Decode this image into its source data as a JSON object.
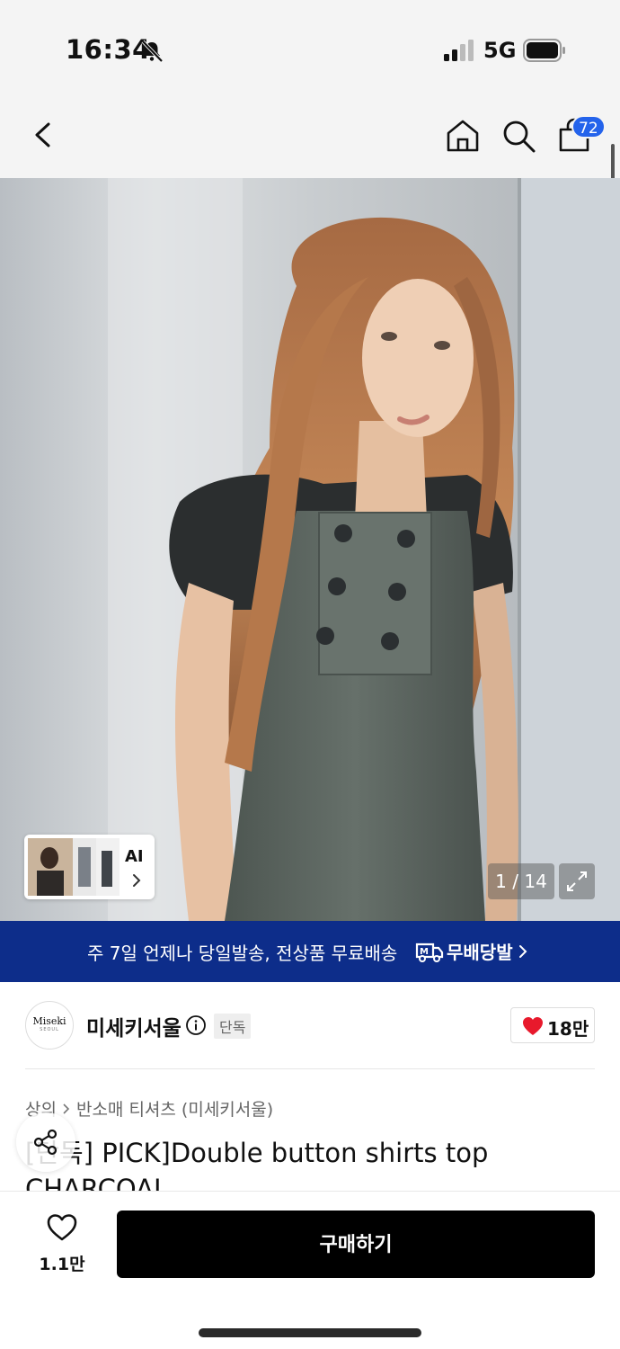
{
  "status_bar": {
    "time": "16:34",
    "network": "5G"
  },
  "header": {
    "cart_count": "72"
  },
  "hero": {
    "ai_label": "AI",
    "counter": "1 / 14"
  },
  "banner": {
    "text": "주 7일 언제나 당일발송, 전상품 무료배송",
    "brand": "무배당발"
  },
  "brand": {
    "logo_text": "Miseki",
    "logo_sub": "SEOUL",
    "name": "미세키서울",
    "exclusive": "단독",
    "likes": "18만"
  },
  "breadcrumb": [
    "상의",
    "반소매 티셔츠 (미세키서울)"
  ],
  "product": {
    "title": "[단독] PICK]Double button shirts top CHARCOAL"
  },
  "bottom_bar": {
    "wish_count": "1.1만",
    "buy_label": "구매하기"
  },
  "colors": {
    "accent": "#2463eb",
    "banner": "#0d2d8a",
    "buy": "#000000",
    "heart": "#e8192c"
  }
}
